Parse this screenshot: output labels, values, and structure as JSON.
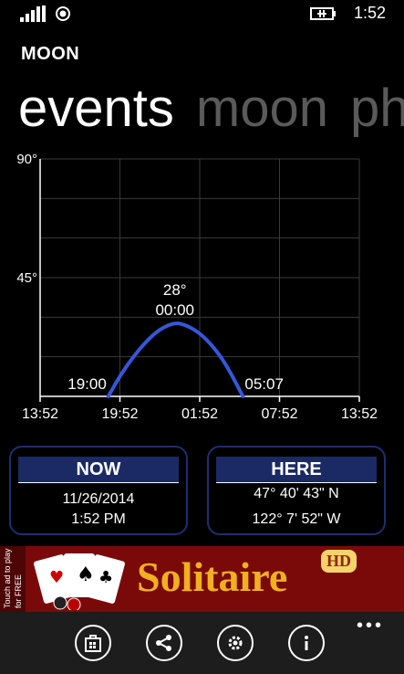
{
  "status_bar": {
    "time": "1:52"
  },
  "app": {
    "title": "MOON"
  },
  "pivot": {
    "items": [
      "events",
      "moon",
      "phase"
    ]
  },
  "chart_data": {
    "type": "line",
    "title": "",
    "xlabel": "",
    "ylabel": "",
    "y_tick_labels": [
      "90°",
      "45°"
    ],
    "x_tick_labels": [
      "13:52",
      "19:52",
      "01:52",
      "07:52",
      "13:52"
    ],
    "x_hours": [
      0,
      6,
      12,
      18,
      24
    ],
    "ylim": [
      0,
      90
    ],
    "xlim": [
      0,
      24
    ],
    "grid": true,
    "series": [
      {
        "values": [
          {
            "x": 5.13,
            "y": 0
          },
          {
            "x": 6,
            "y": 7.8
          },
          {
            "x": 7,
            "y": 15
          },
          {
            "x": 8,
            "y": 21
          },
          {
            "x": 9,
            "y": 25.5
          },
          {
            "x": 10.13,
            "y": 28
          },
          {
            "x": 11,
            "y": 27
          },
          {
            "x": 12,
            "y": 24
          },
          {
            "x": 13,
            "y": 19
          },
          {
            "x": 14,
            "y": 12
          },
          {
            "x": 15.25,
            "y": 0
          }
        ],
        "color": "#3557d8"
      }
    ],
    "annotations": {
      "rise_time": "19:00",
      "set_time": "05:07",
      "peak_altitude": "28°",
      "peak_time": "00:00"
    }
  },
  "now_panel": {
    "header": "NOW",
    "date": "11/26/2014",
    "time": "1:52 PM"
  },
  "here_panel": {
    "header": "HERE",
    "latitude": "47° 40' 43\" N",
    "longitude": "122° 7' 52\" W"
  },
  "ad": {
    "side_text": "Touch ad to play for FREE",
    "title": "Solitaire",
    "badge": "HD"
  },
  "app_bar": {
    "buttons": [
      "store-icon",
      "share-icon",
      "settings-icon",
      "info-icon"
    ],
    "more": "•••"
  }
}
